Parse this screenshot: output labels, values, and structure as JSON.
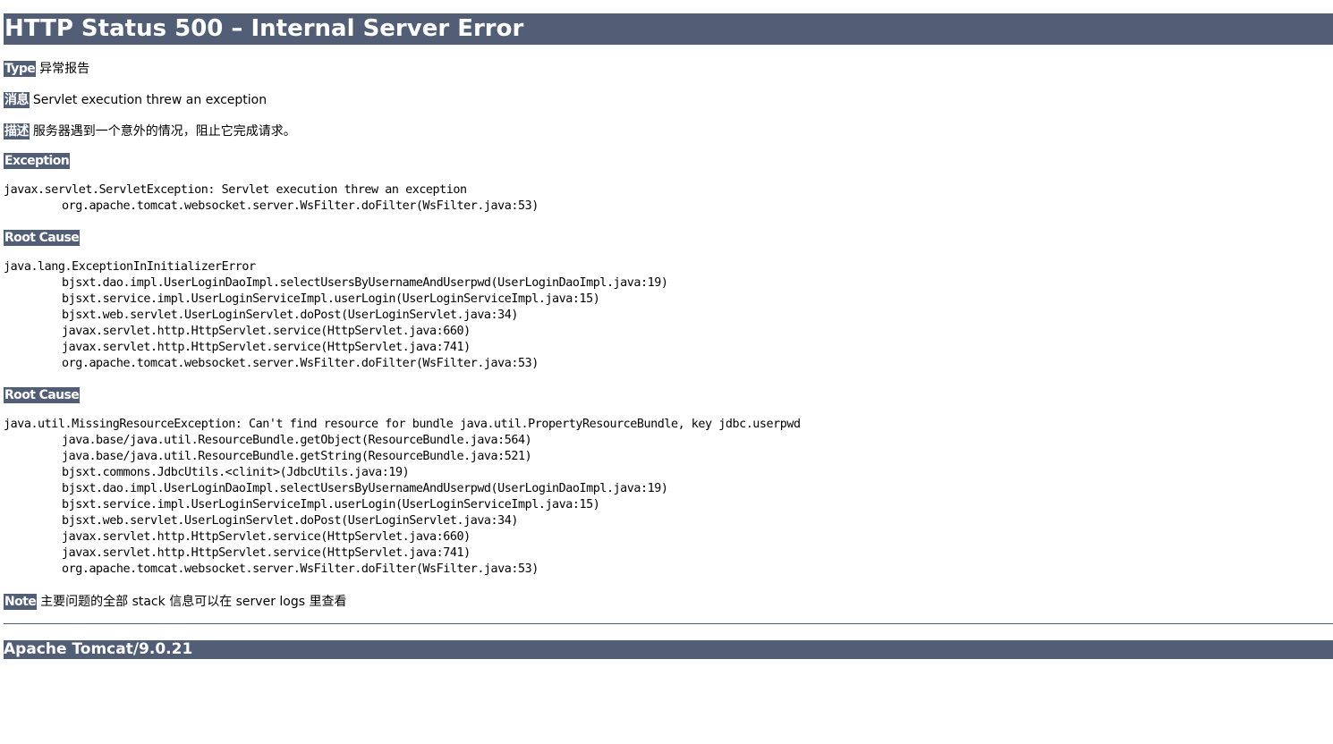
{
  "title": "HTTP Status 500 – Internal Server Error",
  "type": {
    "label": "Type",
    "value": "异常报告"
  },
  "message": {
    "label": "消息",
    "value": "Servlet execution threw an exception"
  },
  "description": {
    "label": "描述",
    "value": "服务器遇到一个意外的情况，阻止它完成请求。"
  },
  "exception": {
    "label": "Exception",
    "lines": [
      "javax.servlet.ServletException: Servlet execution threw an exception",
      "org.apache.tomcat.websocket.server.WsFilter.doFilter(WsFilter.java:53)"
    ]
  },
  "root_cause_1": {
    "label": "Root Cause",
    "lines": [
      "java.lang.ExceptionInInitializerError",
      "bjsxt.dao.impl.UserLoginDaoImpl.selectUsersByUsernameAndUserpwd(UserLoginDaoImpl.java:19)",
      "bjsxt.service.impl.UserLoginServiceImpl.userLogin(UserLoginServiceImpl.java:15)",
      "bjsxt.web.servlet.UserLoginServlet.doPost(UserLoginServlet.java:34)",
      "javax.servlet.http.HttpServlet.service(HttpServlet.java:660)",
      "javax.servlet.http.HttpServlet.service(HttpServlet.java:741)",
      "org.apache.tomcat.websocket.server.WsFilter.doFilter(WsFilter.java:53)"
    ]
  },
  "root_cause_2": {
    "label": "Root Cause",
    "lines": [
      "java.util.MissingResourceException: Can't find resource for bundle java.util.PropertyResourceBundle, key jdbc.userpwd",
      "java.base/java.util.ResourceBundle.getObject(ResourceBundle.java:564)",
      "java.base/java.util.ResourceBundle.getString(ResourceBundle.java:521)",
      "bjsxt.commons.JdbcUtils.<clinit>(JdbcUtils.java:19)",
      "bjsxt.dao.impl.UserLoginDaoImpl.selectUsersByUsernameAndUserpwd(UserLoginDaoImpl.java:19)",
      "bjsxt.service.impl.UserLoginServiceImpl.userLogin(UserLoginServiceImpl.java:15)",
      "bjsxt.web.servlet.UserLoginServlet.doPost(UserLoginServlet.java:34)",
      "javax.servlet.http.HttpServlet.service(HttpServlet.java:660)",
      "javax.servlet.http.HttpServlet.service(HttpServlet.java:741)",
      "org.apache.tomcat.websocket.server.WsFilter.doFilter(WsFilter.java:53)"
    ]
  },
  "note": {
    "label": "Note",
    "value": "主要问题的全部 stack 信息可以在 server logs 里查看"
  },
  "footer": "Apache Tomcat/9.0.21",
  "colors": {
    "header_bg": "#525d76",
    "header_text": "#ffffff"
  }
}
